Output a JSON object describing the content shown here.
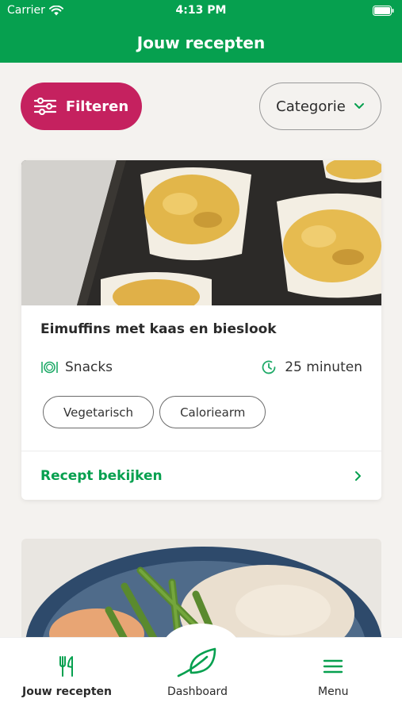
{
  "status_bar": {
    "carrier": "Carrier",
    "time": "4:13 PM"
  },
  "header": {
    "title": "Jouw recepten"
  },
  "toolbar": {
    "filter_label": "Filteren",
    "category_label": "Categorie"
  },
  "recipes": [
    {
      "title": "Eimuffins met kaas en bieslook",
      "category": "Snacks",
      "duration": "25 minuten",
      "tags": [
        "Vegetarisch",
        "Caloriearm"
      ],
      "link_label": "Recept bekijken"
    }
  ],
  "tab_bar": {
    "items": [
      {
        "label": "Jouw recepten",
        "icon": "fork-knife-icon",
        "active": true
      },
      {
        "label": "Dashboard",
        "icon": "leaf-icon",
        "active": false
      },
      {
        "label": "Menu",
        "icon": "hamburger-menu-icon",
        "active": false
      }
    ]
  },
  "colors": {
    "brand_green": "#06a04f",
    "filter_magenta": "#c5215f",
    "background": "#f4f2ef"
  }
}
